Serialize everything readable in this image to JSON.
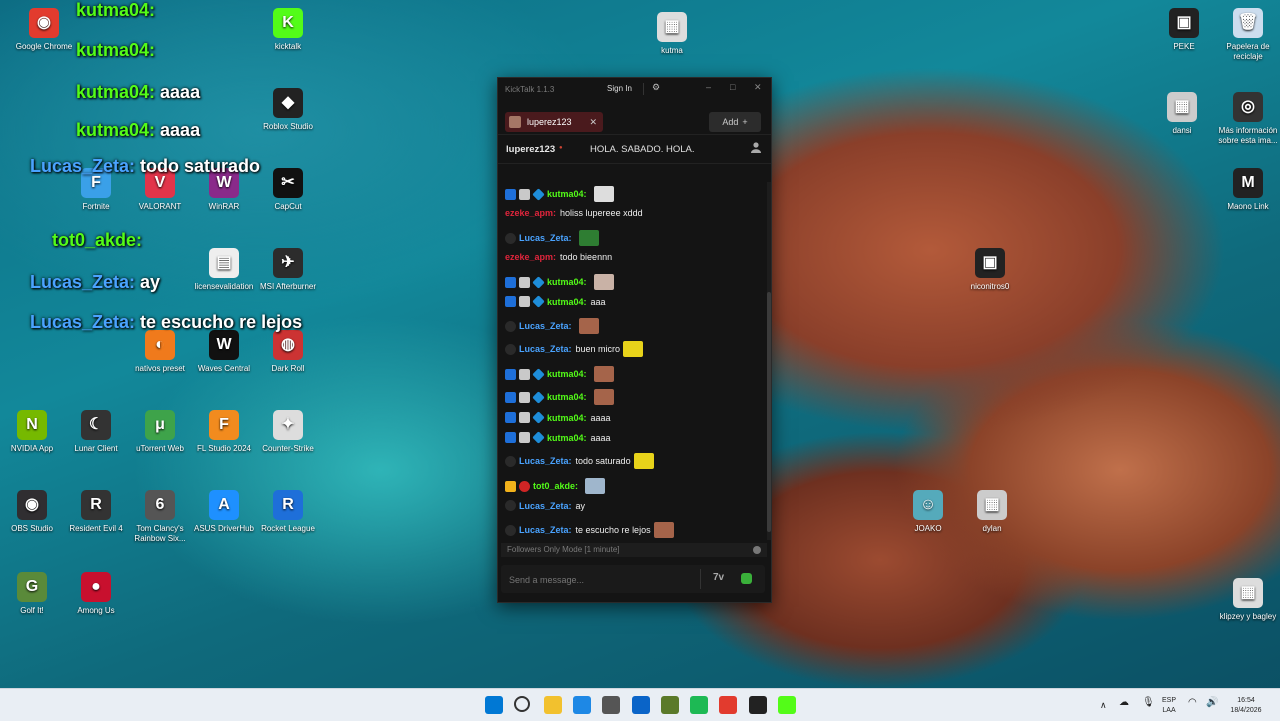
{
  "desktop": {
    "icons": [
      {
        "label": "Google Chrome",
        "x": "",
        "c": "#e23b2e",
        "g": "◉"
      },
      {
        "label": "kicktalk",
        "c": "#53fc18",
        "g": "K"
      },
      {
        "label": "kutma",
        "c": "#ddd",
        "g": "▦"
      },
      {
        "label": "PEKE",
        "c": "#222",
        "g": "▣"
      },
      {
        "label": "Papelera de reciclaje",
        "c": "#cde",
        "g": "🗑"
      },
      {
        "label": "Roblox Studio",
        "c": "#222",
        "g": "◆"
      },
      {
        "label": "dansi",
        "c": "#ccc",
        "g": "▦"
      },
      {
        "label": "Más información sobre esta ima...",
        "c": "#333",
        "g": "◎"
      },
      {
        "label": "Fortnite",
        "c": "#3aa0e8",
        "g": "F"
      },
      {
        "label": "VALORANT",
        "c": "#e2344a",
        "g": "V"
      },
      {
        "label": "WinRAR",
        "c": "#8a2a8a",
        "g": "W"
      },
      {
        "label": "CapCut",
        "c": "#111",
        "g": "✂"
      },
      {
        "label": "Maono Link",
        "c": "#222",
        "g": "M"
      },
      {
        "label": "licensevalidation",
        "c": "#eee",
        "g": "▤"
      },
      {
        "label": "MSI Afterburner",
        "c": "#2c2c2c",
        "g": "✈"
      },
      {
        "label": "niconitros0",
        "c": "#222",
        "g": "▣"
      },
      {
        "label": "nativos preset",
        "c": "#f07a1c",
        "g": "◐"
      },
      {
        "label": "Waves Central",
        "c": "#111",
        "g": "W"
      },
      {
        "label": "Dark Roll",
        "c": "#c33",
        "g": "◍"
      },
      {
        "label": "NVIDIA App",
        "c": "#76b900",
        "g": "N"
      },
      {
        "label": "Lunar Client",
        "c": "#333",
        "g": "☾"
      },
      {
        "label": "uTorrent Web",
        "c": "#3ea34a",
        "g": "μ"
      },
      {
        "label": "FL Studio 2024",
        "c": "#f28b1e",
        "g": "F"
      },
      {
        "label": "Counter-Strike",
        "c": "#ddd",
        "g": "✦"
      },
      {
        "label": "OBS Studio",
        "c": "#302e31",
        "g": "◉"
      },
      {
        "label": "Resident Evil 4",
        "c": "#333",
        "g": "R"
      },
      {
        "label": "Tom Clancy's Rainbow Six...",
        "c": "#555",
        "g": "6"
      },
      {
        "label": "ASUS DriverHub",
        "c": "#1e90ff",
        "g": "A"
      },
      {
        "label": "Rocket League",
        "c": "#1e6fd9",
        "g": "R"
      },
      {
        "label": "JOAKO",
        "c": "#5ab",
        "g": "☺"
      },
      {
        "label": "dylan",
        "c": "#ccc",
        "g": "▦"
      },
      {
        "label": "Golf It!",
        "c": "#5a8a3a",
        "g": "G"
      },
      {
        "label": "Among Us",
        "c": "#c8102e",
        "g": "●"
      },
      {
        "label": "klipzey y bagley",
        "c": "#ddd",
        "g": "▦"
      }
    ],
    "overlay": [
      {
        "user": "kutma04:",
        "msg": "",
        "color": "#53fc18"
      },
      {
        "user": "kutma04:",
        "msg": "",
        "color": "#53fc18"
      },
      {
        "user": "kutma04:",
        "msg": "aaaa",
        "color": "#53fc18"
      },
      {
        "user": "kutma04:",
        "msg": "aaaa",
        "color": "#53fc18"
      },
      {
        "user": "Lucas_Zeta:",
        "msg": "todo saturado",
        "color": "#4aa3ff"
      },
      {
        "user": "tot0_akde:",
        "msg": "",
        "color": "#53fc18"
      },
      {
        "user": "Lucas_Zeta:",
        "msg": "ay",
        "color": "#4aa3ff"
      },
      {
        "user": "Lucas_Zeta:",
        "msg": "te escucho re lejos",
        "color": "#4aa3ff"
      }
    ]
  },
  "window": {
    "title": "KickTalk 1.1.3",
    "sign_in": "Sign In",
    "tab_label": "luperez123",
    "add_label": "Add",
    "channel": "luperez123",
    "topic": "HOLA. SABADO. HOLA.",
    "followers_note": "Followers Only Mode [1 minute]",
    "input_placeholder": "Send a message...",
    "messages": [
      {
        "user": "kutma04:",
        "text": "",
        "color": "#53fc18",
        "badges": [
          "mod",
          "av",
          "cube"
        ],
        "emote": "#ddd"
      },
      {
        "user": "ezeke_apm:",
        "text": "holiss lupereee xddd",
        "color": "#e0253c",
        "badges": [],
        "emote": ""
      },
      {
        "user": "Lucas_Zeta:",
        "text": "",
        "color": "#4aa3ff",
        "badges": [
          "hat"
        ],
        "emote": "#2e7d32"
      },
      {
        "user": "ezeke_apm:",
        "text": "todo bieennn",
        "color": "#e0253c",
        "badges": [],
        "emote": ""
      },
      {
        "user": "kutma04:",
        "text": "",
        "color": "#53fc18",
        "badges": [
          "mod",
          "av",
          "cube"
        ],
        "emote": "#c9b2a6"
      },
      {
        "user": "kutma04:",
        "text": "aaa",
        "color": "#53fc18",
        "badges": [
          "mod",
          "av",
          "cube"
        ],
        "emote": ""
      },
      {
        "user": "Lucas_Zeta:",
        "text": "",
        "color": "#4aa3ff",
        "badges": [
          "hat"
        ],
        "emote": "#a5644a"
      },
      {
        "user": "Lucas_Zeta:",
        "text": "buen micro",
        "color": "#4aa3ff",
        "badges": [
          "hat"
        ],
        "emote": "#e8d31a"
      },
      {
        "user": "kutma04:",
        "text": "",
        "color": "#53fc18",
        "badges": [
          "mod",
          "av",
          "cube"
        ],
        "emote": "#a5644a"
      },
      {
        "user": "kutma04:",
        "text": "",
        "color": "#53fc18",
        "badges": [
          "mod",
          "av",
          "cube"
        ],
        "emote": "#a5644a"
      },
      {
        "user": "kutma04:",
        "text": "aaaa",
        "color": "#53fc18",
        "badges": [
          "mod",
          "av",
          "cube"
        ],
        "emote": ""
      },
      {
        "user": "kutma04:",
        "text": "aaaa",
        "color": "#53fc18",
        "badges": [
          "mod",
          "av",
          "cube"
        ],
        "emote": ""
      },
      {
        "user": "Lucas_Zeta:",
        "text": "todo saturado",
        "color": "#4aa3ff",
        "badges": [
          "hat"
        ],
        "emote": "#e8d31a"
      },
      {
        "user": "tot0_akde:",
        "text": "",
        "color": "#53fc18",
        "badges": [
          "crown",
          "red"
        ],
        "emote": "#9fb6cc"
      },
      {
        "user": "Lucas_Zeta:",
        "text": "ay",
        "color": "#4aa3ff",
        "badges": [
          "hat"
        ],
        "emote": ""
      },
      {
        "user": "Lucas_Zeta:",
        "text": "te escucho re lejos",
        "color": "#4aa3ff",
        "badges": [
          "hat"
        ],
        "emote": "#a5644a"
      }
    ]
  },
  "taskbar": {
    "lang": "ESP",
    "lang2": "LAA",
    "time": "16:54",
    "date": "18/4/2026",
    "apps": [
      "windows-start",
      "search",
      "file-explorer",
      "edge",
      "store",
      "outlook",
      "minecraft",
      "spotify",
      "chrome",
      "obs",
      "kick"
    ]
  }
}
